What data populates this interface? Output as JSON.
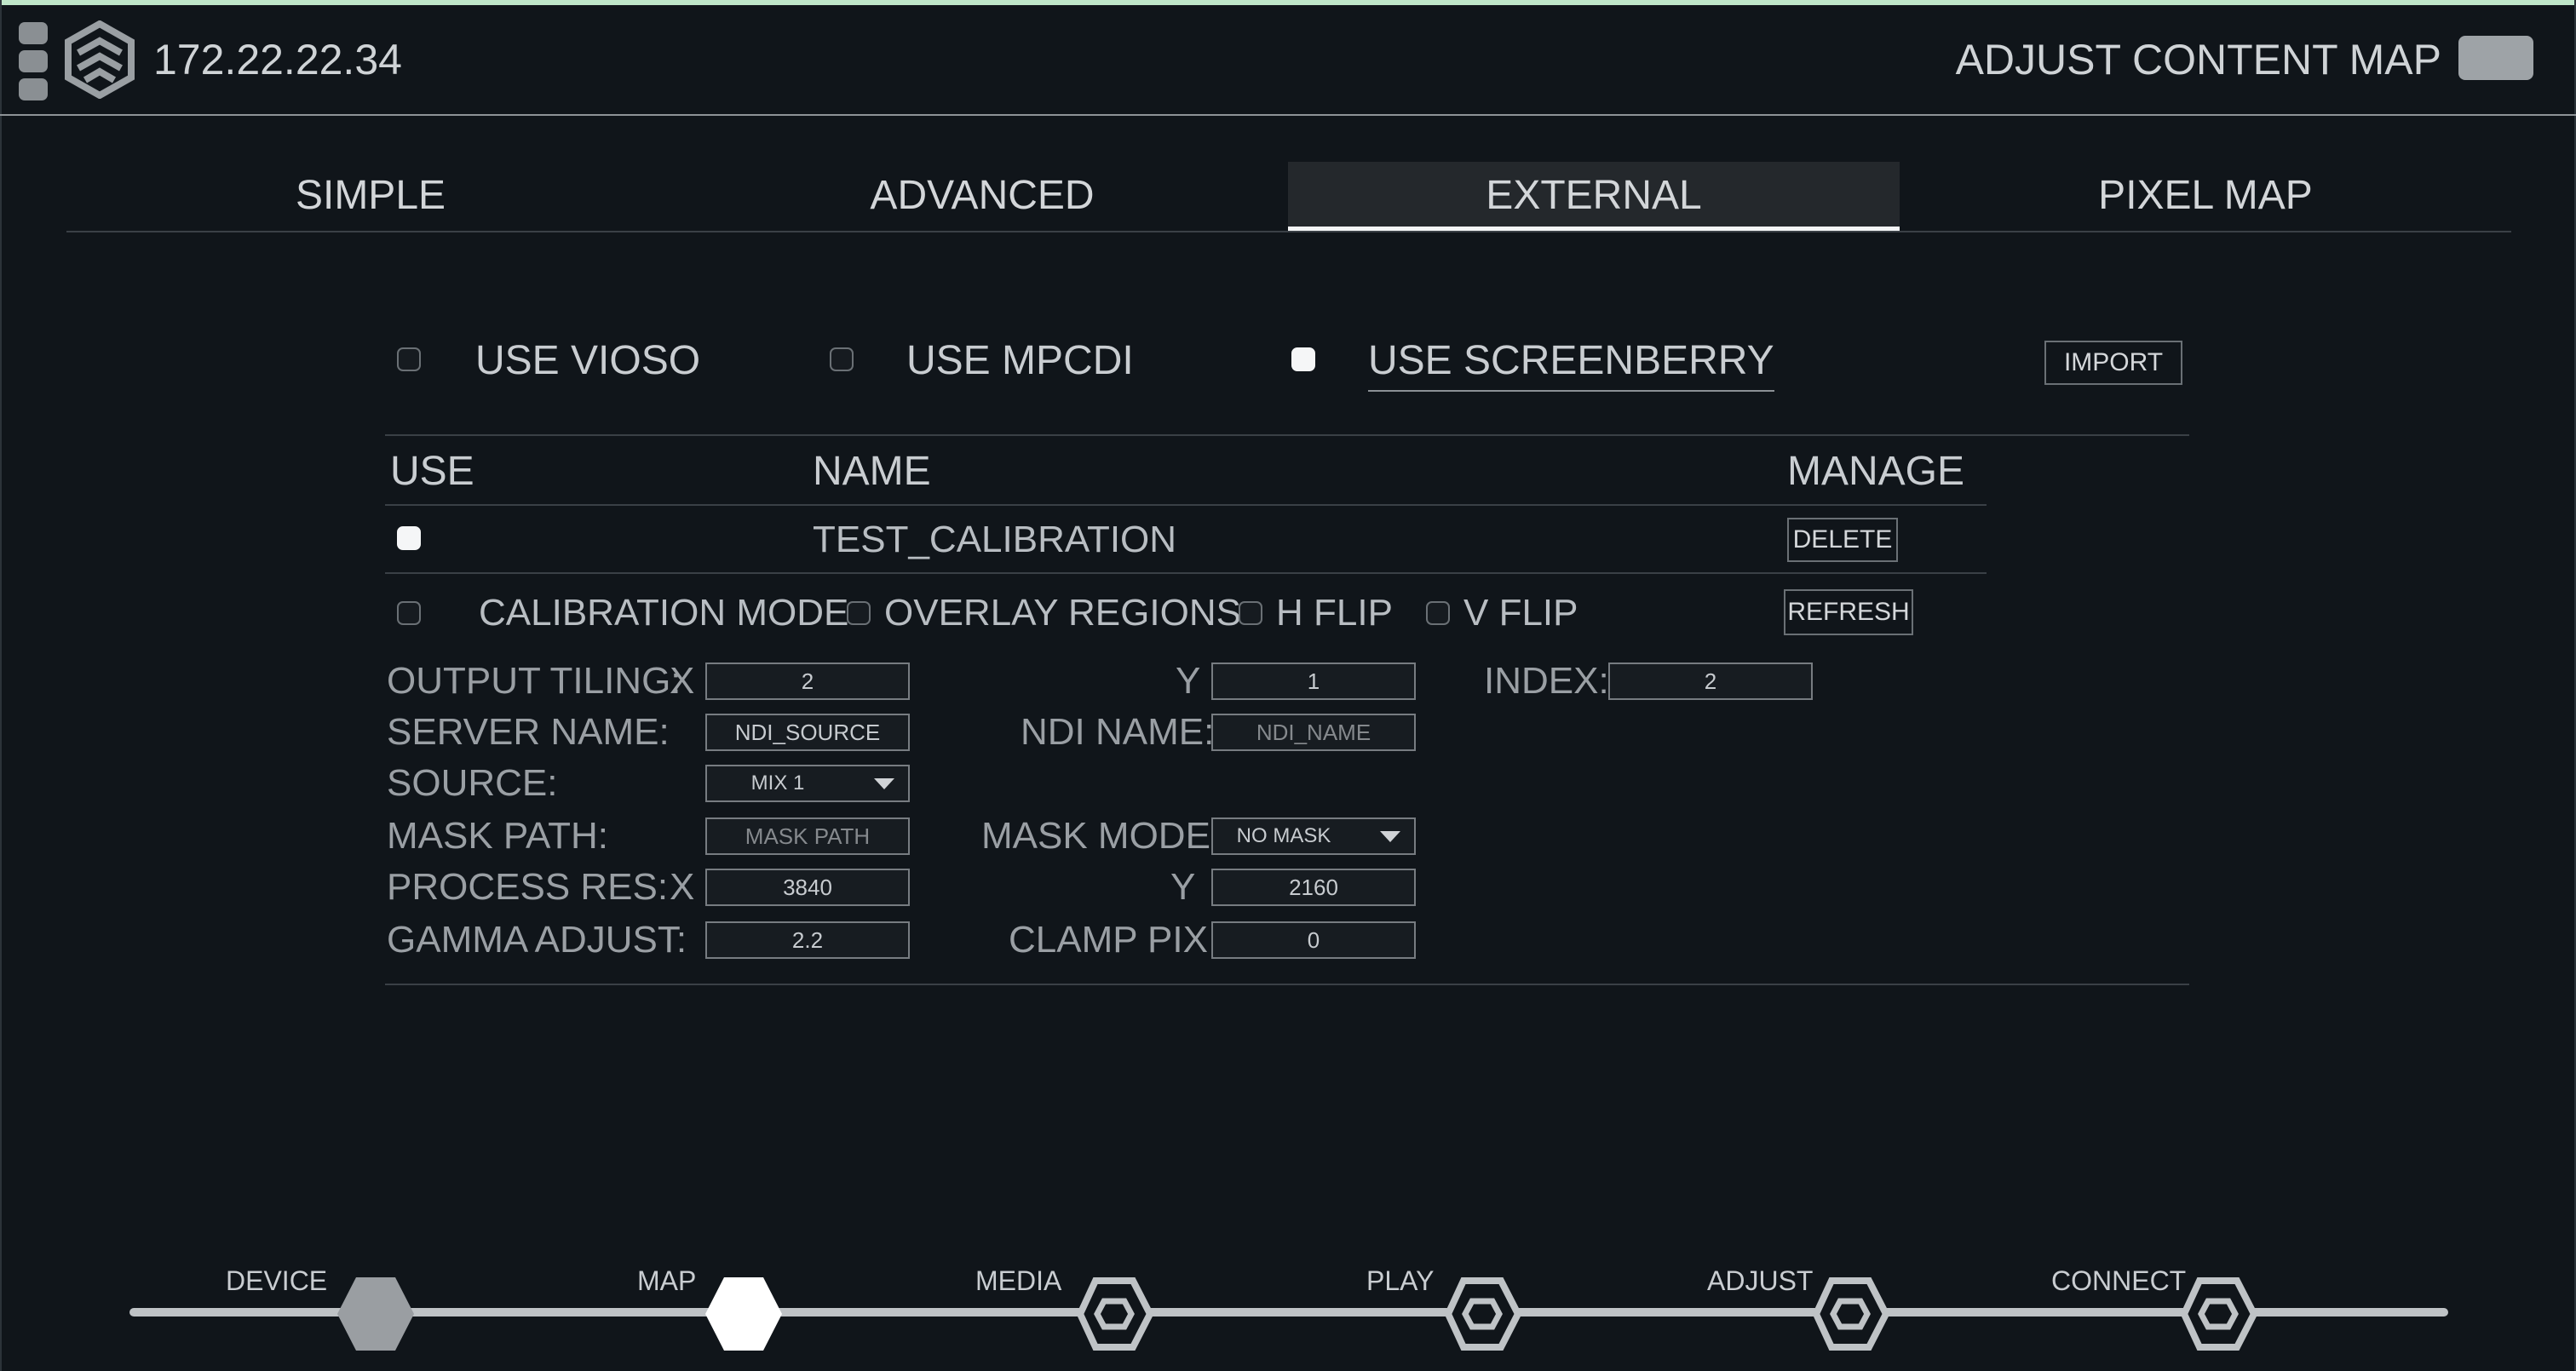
{
  "header": {
    "ip_address": "172.22.22.34",
    "mode_label": "ADJUST CONTENT MAP",
    "menu_icon": "hamburger-menu-icon",
    "logo_icon": "hexagon-logo-icon"
  },
  "tabs": [
    "SIMPLE",
    "ADVANCED",
    "EXTERNAL",
    "PIXEL MAP"
  ],
  "active_tab": "EXTERNAL",
  "sources": {
    "vioso": "USE VIOSO",
    "mpcdi": "USE MPCDI",
    "screenberry": "USE SCREENBERRY",
    "screenberry_checked": true,
    "import": "IMPORT"
  },
  "table": {
    "col_use": "USE",
    "col_name": "NAME",
    "col_manage": "MANAGE",
    "rows": [
      {
        "use_checked": true,
        "name": "TEST_CALIBRATION",
        "action": "DELETE"
      }
    ]
  },
  "options": {
    "calibration_mode": "CALIBRATION MODE",
    "overlay_regions": "OVERLAY REGIONS",
    "h_flip": "H FLIP",
    "v_flip": "V FLIP",
    "refresh": "REFRESH"
  },
  "settings": {
    "output_tiling_label": "OUTPUT TILING:",
    "x_label": "X",
    "y_label": "Y",
    "tiling_x": "2",
    "tiling_y": "1",
    "index_label": "INDEX:",
    "index": "2",
    "server_name_label": "SERVER NAME:",
    "server_name": "NDI_SOURCE",
    "ndi_name_label": "NDI NAME:",
    "ndi_name_placeholder": "NDI_NAME",
    "source_label": "SOURCE:",
    "source": "MIX 1",
    "mask_path_label": "MASK PATH:",
    "mask_path_placeholder": "MASK PATH",
    "mask_mode_label": "MASK MODE:",
    "mask_mode": "NO MASK",
    "process_res_label": "PROCESS RES:",
    "process_x": "3840",
    "process_y": "2160",
    "gamma_label": "GAMMA ADJUST:",
    "gamma": "2.2",
    "clamp_label": "CLAMP PIX:",
    "clamp": "0"
  },
  "workflow": {
    "nodes": [
      "DEVICE",
      "MAP",
      "MEDIA",
      "PLAY",
      "ADJUST",
      "CONNECT"
    ],
    "current": "MAP"
  },
  "colors": {
    "background": "#10151a",
    "text": "#c4c9ce",
    "accent": "#f5f6f7",
    "node_inactive": "#9a9ea2"
  }
}
